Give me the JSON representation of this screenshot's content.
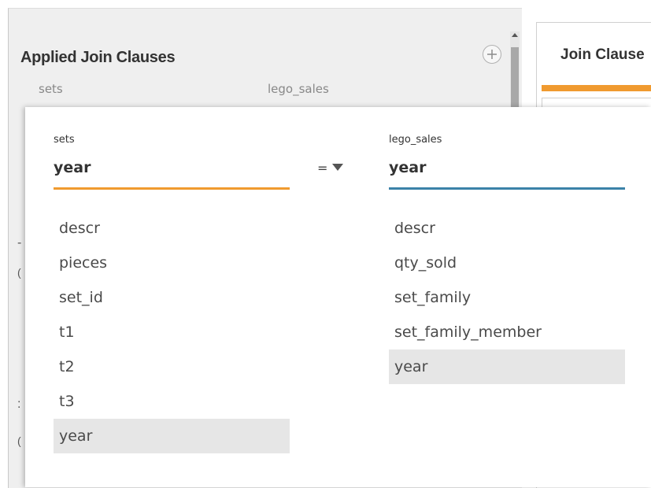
{
  "background": {
    "title": "Applied Join Clauses",
    "col_left": "sets",
    "col_right": "lego_sales",
    "right_panel_title": "Join Clause"
  },
  "join_clause": {
    "left": {
      "source": "sets",
      "selected": "year",
      "fields": [
        "descr",
        "pieces",
        "set_id",
        "t1",
        "t2",
        "t3",
        "year"
      ]
    },
    "operator": "=",
    "right": {
      "source": "lego_sales",
      "selected": "year",
      "fields": [
        "descr",
        "qty_sold",
        "set_family",
        "set_family_member",
        "year"
      ]
    }
  },
  "colors": {
    "left_accent": "#f09a2f",
    "right_accent": "#3b82a8",
    "selected_row": "#e6e6e6"
  }
}
